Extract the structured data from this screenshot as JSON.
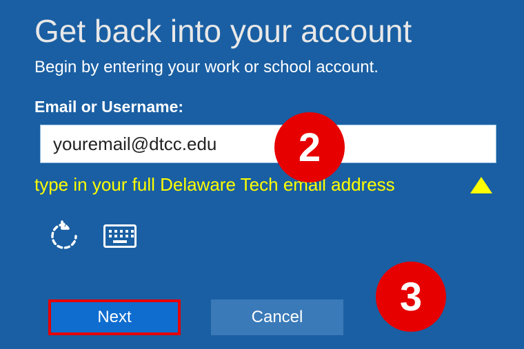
{
  "title": "Get back into your account",
  "subtitle": "Begin by entering your work or school account.",
  "field": {
    "label": "Email or Username:",
    "value": "youremail@dtcc.edu"
  },
  "hint": {
    "text": "type in your full Delaware Tech email address"
  },
  "icons": {
    "refresh": "refresh-icon",
    "keyboard": "keyboard-icon"
  },
  "buttons": {
    "next": "Next",
    "cancel": "Cancel"
  },
  "badges": {
    "step2": "2",
    "step3": "3"
  }
}
